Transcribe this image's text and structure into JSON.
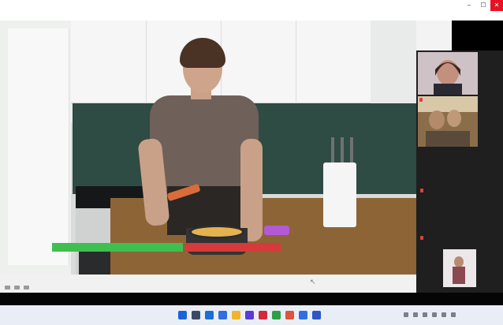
{
  "window": {
    "title": "",
    "controls": {
      "minimize": "–",
      "maximize": "☐",
      "close": "✕"
    }
  },
  "menu": {
    "items": [
      "",
      "",
      "",
      ""
    ]
  },
  "video_labels": {
    "green": "",
    "red": ""
  },
  "participants": [
    {
      "name": "",
      "muted": true
    },
    {
      "name": "",
      "muted": true
    },
    {
      "name": "",
      "muted": true
    },
    {
      "name": "",
      "muted": true
    },
    {
      "name": "",
      "muted": true
    },
    {
      "name": "",
      "muted": false
    },
    {
      "name": "",
      "muted": false
    }
  ],
  "bottom_strip": {
    "left": "",
    "right": ""
  },
  "taskbar": {
    "icons": [
      {
        "name": "start-icon",
        "color": "#1e63d6"
      },
      {
        "name": "search-icon",
        "color": "#3a4a66"
      },
      {
        "name": "browser-icon",
        "color": "#1b6fd1"
      },
      {
        "name": "chat-icon",
        "color": "#2f6fe0"
      },
      {
        "name": "file-explorer-icon",
        "color": "#f0b52b"
      },
      {
        "name": "store-icon",
        "color": "#5a3bd6"
      },
      {
        "name": "media-icon",
        "color": "#d6283b"
      },
      {
        "name": "chrome-icon",
        "color": "#2f9e44"
      },
      {
        "name": "mail-icon",
        "color": "#e0533d"
      },
      {
        "name": "photos-icon",
        "color": "#2f6fe0"
      },
      {
        "name": "camera-icon",
        "color": "#2b57c8"
      }
    ],
    "time": "",
    "date": ""
  }
}
